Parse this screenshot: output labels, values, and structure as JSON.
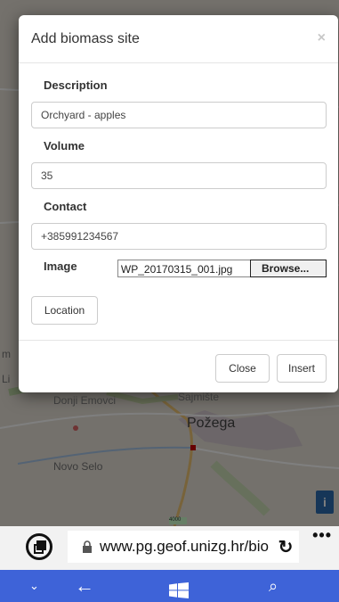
{
  "map": {
    "labels": [
      "Donji Emovci",
      "Sajmište",
      "Požega",
      "Novo Selo",
      "m",
      "Li"
    ],
    "info_label": "i",
    "scale_label": "4000"
  },
  "modal": {
    "title": "Add biomass site",
    "close_symbol": "×",
    "description_label": "Description",
    "description_value": "Orchyard - apples",
    "volume_label": "Volume",
    "volume_value": "35",
    "contact_label": "Contact",
    "contact_value": "+385991234567",
    "image_label": "Image",
    "image_file": "WP_20170315_001.jpg",
    "browse_label": "Browse...",
    "location_button": "Location",
    "close_button": "Close",
    "insert_button": "Insert"
  },
  "browser": {
    "url": "www.pg.geof.unizg.hr/bio",
    "refresh_icon": "↻",
    "more_icon": "•••"
  },
  "nav": {
    "down_icon": "⌄",
    "back_icon": "←",
    "search_icon": "⌕"
  }
}
